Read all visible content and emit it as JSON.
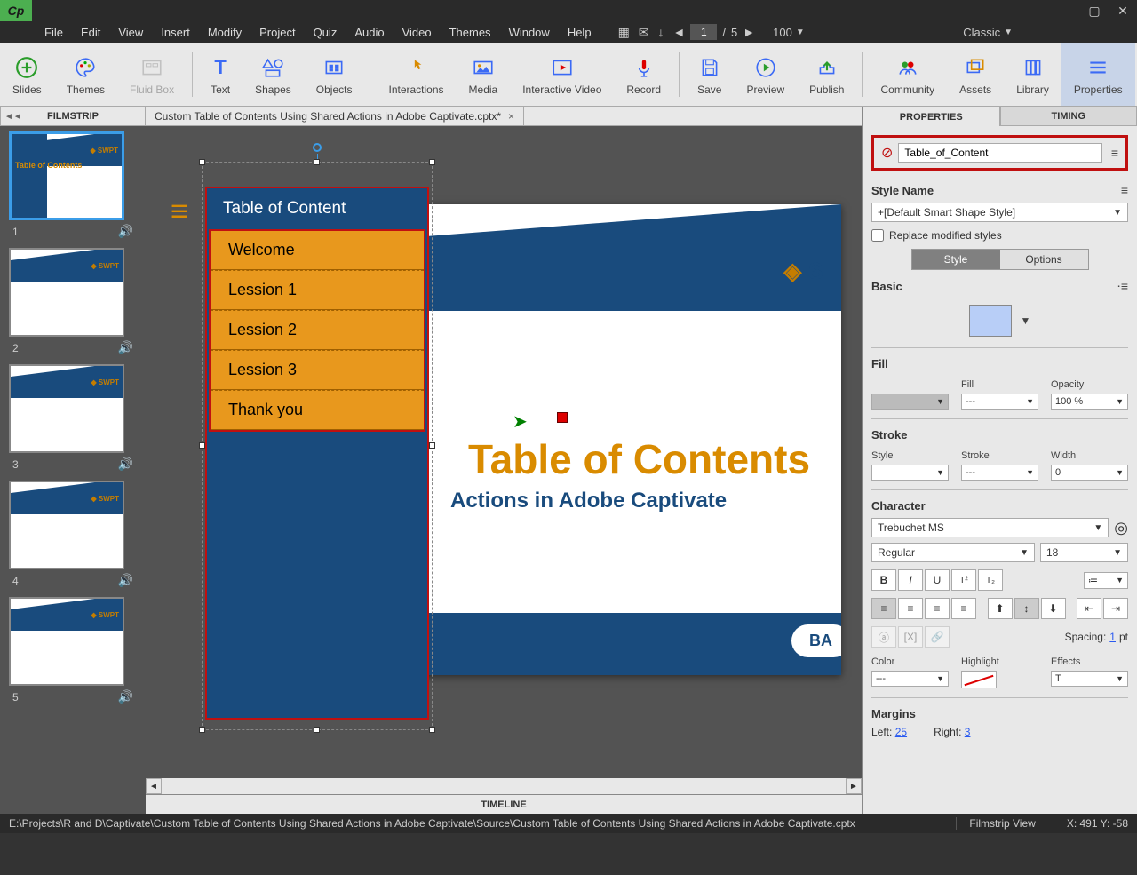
{
  "menubar": {
    "items": [
      "File",
      "Edit",
      "View",
      "Insert",
      "Modify",
      "Project",
      "Quiz",
      "Audio",
      "Video",
      "Themes",
      "Window",
      "Help"
    ],
    "page_current": "1",
    "page_sep": "/",
    "page_total": "5",
    "zoom": "100",
    "workspace": "Classic"
  },
  "toolbar": {
    "groups": [
      [
        "Slides",
        "Themes",
        "Fluid Box"
      ],
      [
        "Text",
        "Shapes",
        "Objects"
      ],
      [
        "Interactions",
        "Media",
        "Interactive Video",
        "Record"
      ],
      [
        "Save",
        "Preview",
        "Publish"
      ],
      [
        "Community",
        "Assets",
        "Library",
        "Properties"
      ]
    ]
  },
  "filmstrip": {
    "title": "FILMSTRIP",
    "slides": [
      {
        "num": "1"
      },
      {
        "num": "2"
      },
      {
        "num": "3"
      },
      {
        "num": "4"
      },
      {
        "num": "5"
      }
    ]
  },
  "document": {
    "tab_title": "Custom Table of Contents Using Shared Actions in Adobe Captivate.cptx*"
  },
  "slide": {
    "toc_header": "Table of Content",
    "toc_items": [
      "Welcome",
      "Lession 1",
      "Lession 2",
      "Lession 3",
      "Thank you"
    ],
    "title": "Table of Contents",
    "subtitle": "Actions in Adobe Captivate",
    "back_btn": "BA",
    "logo_text": "S"
  },
  "timeline": {
    "title": "TIMELINE"
  },
  "properties": {
    "tabs": {
      "props": "PROPERTIES",
      "timing": "TIMING"
    },
    "object_name": "Table_of_Content",
    "style_name_label": "Style Name",
    "style_value": "+[Default Smart Shape Style]",
    "replace_styles": "Replace modified styles",
    "subtabs": {
      "style": "Style",
      "options": "Options"
    },
    "basic": {
      "label": "Basic"
    },
    "fill": {
      "label": "Fill",
      "fill_label": "Fill",
      "fill_value": "---",
      "opacity_label": "Opacity",
      "opacity_value": "100 %"
    },
    "stroke": {
      "label": "Stroke",
      "style_label": "Style",
      "stroke_label": "Stroke",
      "stroke_value": "---",
      "width_label": "Width",
      "width_value": "0"
    },
    "character": {
      "label": "Character",
      "font": "Trebuchet MS",
      "weight": "Regular",
      "size": "18",
      "spacing_label": "Spacing:",
      "spacing_value": "1",
      "spacing_unit": "pt",
      "color_label": "Color",
      "color_value": "---",
      "highlight_label": "Highlight",
      "effects_label": "Effects"
    },
    "margins": {
      "label": "Margins",
      "left_label": "Left:",
      "left_value": "25",
      "right_label": "Right:",
      "right_value": "3"
    }
  },
  "statusbar": {
    "path": "E:\\Projects\\R and D\\Captivate\\Custom Table of Contents Using Shared Actions in Adobe Captivate\\Source\\Custom Table of Contents Using Shared Actions in Adobe Captivate.cptx",
    "view": "Filmstrip View",
    "coords": "X: 491 Y: -58"
  }
}
